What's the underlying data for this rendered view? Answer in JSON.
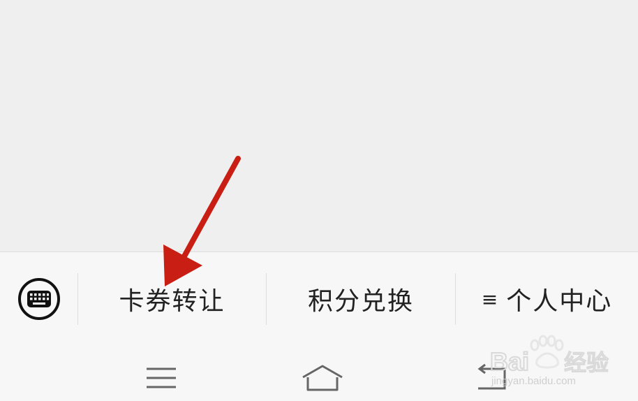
{
  "menu": {
    "items": [
      {
        "label": "卡券转让"
      },
      {
        "label": "积分兑换"
      },
      {
        "label": "个人中心",
        "prefix": "≡"
      }
    ]
  },
  "system_nav": {
    "buttons": [
      "menu-icon",
      "home-icon",
      "back-icon"
    ]
  },
  "annotation": {
    "arrow_color": "#c81e14"
  },
  "watermark": {
    "brand": "Baidu经验",
    "url": "jingyan.baidu.com"
  }
}
